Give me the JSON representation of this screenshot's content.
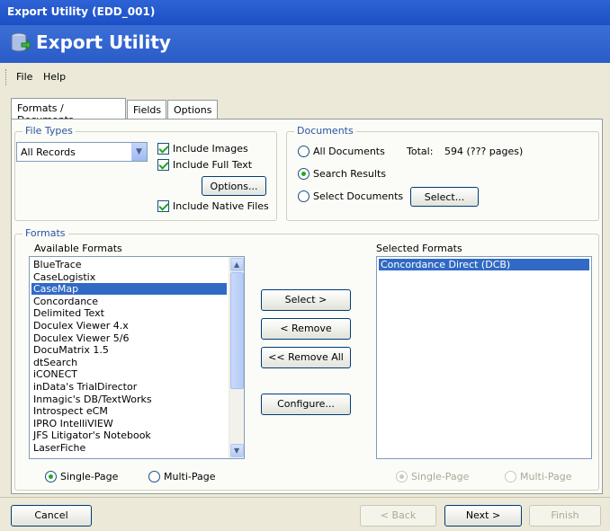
{
  "window": {
    "title": "Export Utility (EDD_001)"
  },
  "header": {
    "title": "Export Utility",
    "logo": "database-export-icon"
  },
  "menu": [
    {
      "label": "File"
    },
    {
      "label": "Help"
    }
  ],
  "tabs": [
    {
      "label": "Formats / Documents"
    },
    {
      "label": "Fields"
    },
    {
      "label": "Options"
    }
  ],
  "file_types": {
    "legend": "File Types",
    "dropdown_value": "All Records",
    "include_images": "Include Images",
    "include_full_text": "Include Full Text",
    "options_button": "Options...",
    "include_native": "Include Native Files"
  },
  "documents": {
    "legend": "Documents",
    "all_documents": "All Documents",
    "total_label": "Total:",
    "total_value": "594 (??? pages)",
    "search_results": "Search Results",
    "select_documents": "Select Documents",
    "select_button": "Select..."
  },
  "formats": {
    "legend": "Formats",
    "available_label": "Available Formats",
    "available": [
      "BlueTrace",
      "CaseLogistix",
      "CaseMap",
      "Concordance",
      "Delimited Text",
      "Doculex Viewer 4.x",
      "Doculex Viewer 5/6",
      "DocuMatrix 1.5",
      "dtSearch",
      "iCONECT",
      "inData's TrialDirector",
      "Inmagic's DB/TextWorks",
      "Introspect eCM",
      "IPRO IntelliVIEW",
      "JFS Litigator's Notebook",
      "LaserFiche"
    ],
    "selected_index": 2,
    "selected_label": "Selected Formats",
    "selected": [
      "Concordance Direct (DCB)"
    ],
    "select_btn": "Select >",
    "remove_btn": "< Remove",
    "remove_all_btn": "<< Remove All",
    "configure_btn": "Configure...",
    "single_page": "Single-Page",
    "multi_page": "Multi-Page"
  },
  "footer": {
    "cancel": "Cancel",
    "back": "< Back",
    "next": "Next >",
    "finish": "Finish"
  },
  "colors": {
    "title_bar": "#1c4fc4",
    "selection": "#316ac5",
    "legend_text": "#2855a3"
  }
}
